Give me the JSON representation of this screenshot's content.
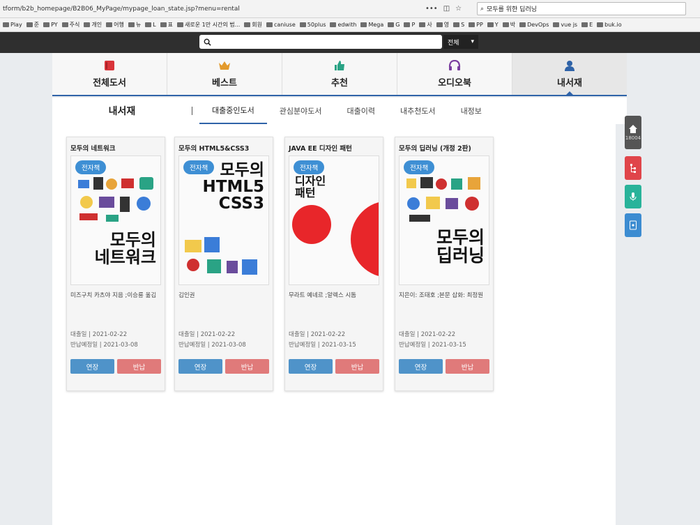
{
  "browser": {
    "url": "tform/b2b_homepage/B2B06_MyPage/mypage_loan_state.jsp?menu=rental",
    "search_value": "모두를 위한 딥러닝",
    "bookmarks": [
      "Play",
      "준",
      "PY",
      "주식",
      "개인",
      "어행",
      "뉴",
      "L",
      "표",
      "새로운 1만 시간의 법...",
      "회원",
      "caniuse",
      "50plus",
      "edwith",
      "Mega",
      "G",
      "P",
      "사",
      "영",
      "S",
      "PP",
      "Y",
      "박",
      "DevOps",
      "vue js",
      "E",
      "buk.io"
    ]
  },
  "site_search": {
    "placeholder": "",
    "scope": "전체"
  },
  "main_tabs": [
    {
      "label": "전체도서",
      "icon": "book-icon",
      "color": "#d9343a"
    },
    {
      "label": "베스트",
      "icon": "crown-icon",
      "color": "#e39a2c"
    },
    {
      "label": "추천",
      "icon": "thumbs-up-icon",
      "color": "#2aa385"
    },
    {
      "label": "오디오북",
      "icon": "headphones-icon",
      "color": "#7b3fa0"
    },
    {
      "label": "내서재",
      "icon": "user-icon",
      "color": "#2f63a8",
      "active": true
    }
  ],
  "sub_nav": {
    "title": "내서재",
    "tabs": [
      "대출중인도서",
      "관심분야도서",
      "대출이력",
      "내추천도서",
      "내정보"
    ],
    "active": 0
  },
  "books": [
    {
      "title": "모두의 네트워크",
      "badge": "전자책",
      "cover_text": "모두의\n네트워크",
      "author": "미즈구치 카츠야 지음 ;이승룡 옮김",
      "loan_date": "대출일 | 2021-02-22",
      "return_date": "반납예정일 | 2021-03-08"
    },
    {
      "title": "모두의 HTML5&CSS3",
      "badge": "전자책",
      "cover_text": "모두의\nHTML5\nCSS3",
      "author": "김인권",
      "loan_date": "대출일 | 2021-02-22",
      "return_date": "반납예정일 | 2021-03-08"
    },
    {
      "title": "JAVA EE 디자인 패턴",
      "badge": "전자책",
      "cover_text": "디자인\n패턴",
      "author": "무라트 예네르 ;알렉스 시돔",
      "loan_date": "대출일 | 2021-02-22",
      "return_date": "반납예정일 | 2021-03-15"
    },
    {
      "title": "모두의 딥러닝 (개정 2판)",
      "badge": "전자책",
      "cover_text": "모두의\n딥러닝",
      "author": "지은이: 조태호 ;본문 삽화: 최정원",
      "loan_date": "대출일 | 2021-02-22",
      "return_date": "반납예정일 | 2021-03-15"
    }
  ],
  "buttons": {
    "extend": "연장",
    "return": "반납"
  },
  "quick_menu": {
    "home_count": "18004"
  }
}
